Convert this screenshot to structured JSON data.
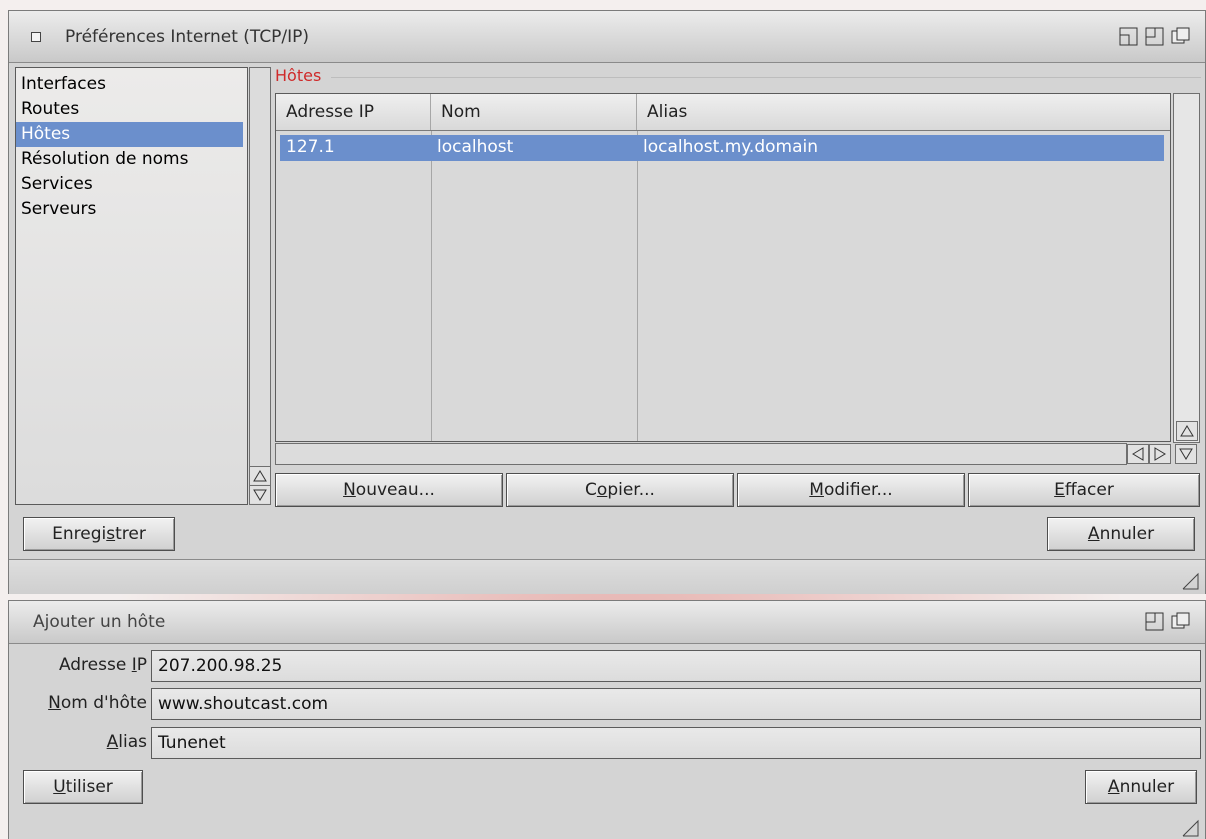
{
  "main_window": {
    "title": "Préférences Internet (TCP/IP)",
    "sidebar_items": [
      {
        "label": "Interfaces",
        "selected": false
      },
      {
        "label": "Routes",
        "selected": false
      },
      {
        "label": "Hôtes",
        "selected": true
      },
      {
        "label": "Résolution de noms",
        "selected": false
      },
      {
        "label": "Services",
        "selected": false
      },
      {
        "label": "Serveurs",
        "selected": false
      }
    ],
    "group_label": "Hôtes",
    "table": {
      "columns": [
        "Adresse IP",
        "Nom",
        "Alias"
      ],
      "rows": [
        {
          "ip": "127.1",
          "name": "localhost",
          "alias": "localhost.my.domain",
          "selected": true
        }
      ]
    },
    "buttons": {
      "new": {
        "pre": "",
        "key": "N",
        "post": "ouveau..."
      },
      "copy": {
        "pre": "C",
        "key": "o",
        "post": "pier..."
      },
      "modify": {
        "pre": "",
        "key": "M",
        "post": "odifier..."
      },
      "delete": {
        "pre": "",
        "key": "E",
        "post": "ffacer"
      },
      "save": {
        "pre": "Enregi",
        "key": "s",
        "post": "trer"
      },
      "cancel": {
        "pre": "",
        "key": "A",
        "post": "nnuler"
      }
    }
  },
  "add_host_window": {
    "title": "Ajouter un hôte",
    "fields": {
      "ip": {
        "label_pre": "Adresse ",
        "label_key": "I",
        "label_post": "P",
        "value": "207.200.98.25"
      },
      "hostname": {
        "label_pre": "",
        "label_key": "N",
        "label_post": "om d'hôte",
        "value": "www.shoutcast.com"
      },
      "alias": {
        "label_pre": "",
        "label_key": "A",
        "label_post": "lias",
        "value": "Tunenet"
      }
    },
    "buttons": {
      "use": {
        "pre": "",
        "key": "U",
        "post": "tiliser"
      },
      "cancel": {
        "pre": "",
        "key": "A",
        "post": "nnuler"
      }
    }
  },
  "colors": {
    "selection": "#6b8fcc",
    "group_label": "#cf2a2a"
  }
}
